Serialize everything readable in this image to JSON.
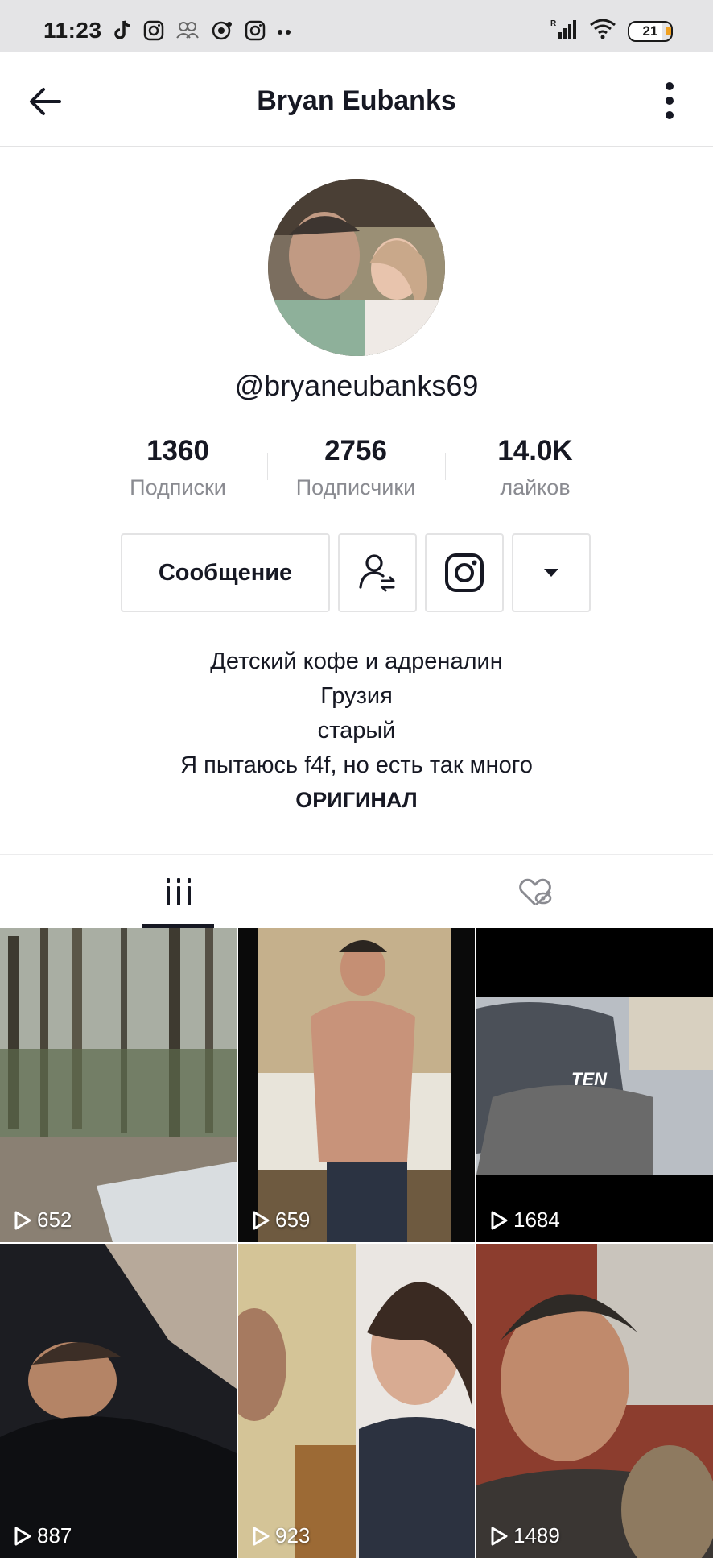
{
  "status_bar": {
    "time": "11:23",
    "battery": "21"
  },
  "header": {
    "title": "Bryan Eubanks"
  },
  "profile": {
    "username": "@bryaneubanks69",
    "stats": [
      {
        "value": "1360",
        "label": "Подписки"
      },
      {
        "value": "2756",
        "label": "Подписчики"
      },
      {
        "value": "14.0K",
        "label": "лайков"
      }
    ]
  },
  "actions": {
    "message_label": "Сообщение"
  },
  "bio": {
    "lines": [
      "Детский кофе и адреналин",
      "Грузия",
      "старый",
      "Я пытаюсь f4f, но есть так много"
    ],
    "bold_line": "ОРИГИНАЛ"
  },
  "tabs": [
    {
      "name": "videos",
      "icon": "grid-lines-icon"
    },
    {
      "name": "liked",
      "icon": "heart-hidden-icon"
    }
  ],
  "videos": [
    {
      "views": "652"
    },
    {
      "views": "659"
    },
    {
      "views": "1684"
    },
    {
      "views": "887"
    },
    {
      "views": "923"
    },
    {
      "views": "1489"
    }
  ],
  "video_thumbnail_text": {
    "overlay_3": "TEN"
  },
  "colors": {
    "text_primary": "#161823",
    "text_secondary": "#8a8b91",
    "border": "#e3e3e4",
    "status_bar_bg": "#e4e4e6",
    "battery_tip": "#f0a020"
  }
}
